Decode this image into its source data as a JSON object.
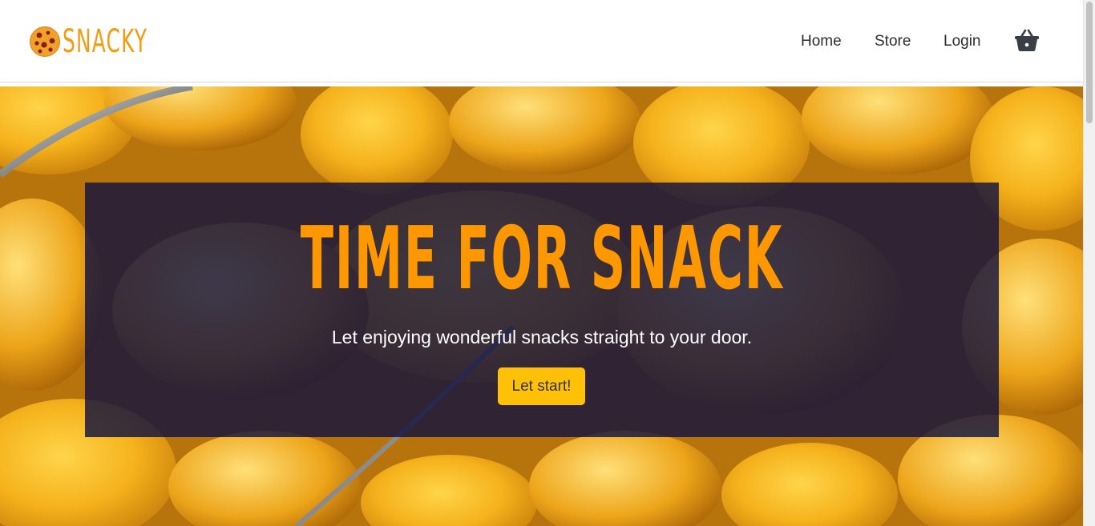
{
  "brand": {
    "name": "SNACKY",
    "logo_icon": "cookie-icon",
    "color": "#f39c12"
  },
  "nav": {
    "items": [
      {
        "label": "Home"
      },
      {
        "label": "Store"
      },
      {
        "label": "Login"
      }
    ],
    "cart_icon": "basket-icon"
  },
  "hero": {
    "title": "TIME FOR SNACK",
    "subtitle": "Let enjoying wonderful snacks straight to your door.",
    "cta_label": "Let start!",
    "background": "snack-mix-photo",
    "colors": {
      "title": "#ff9800",
      "overlay": "#0c0f3e",
      "button": "#ffc107"
    }
  }
}
